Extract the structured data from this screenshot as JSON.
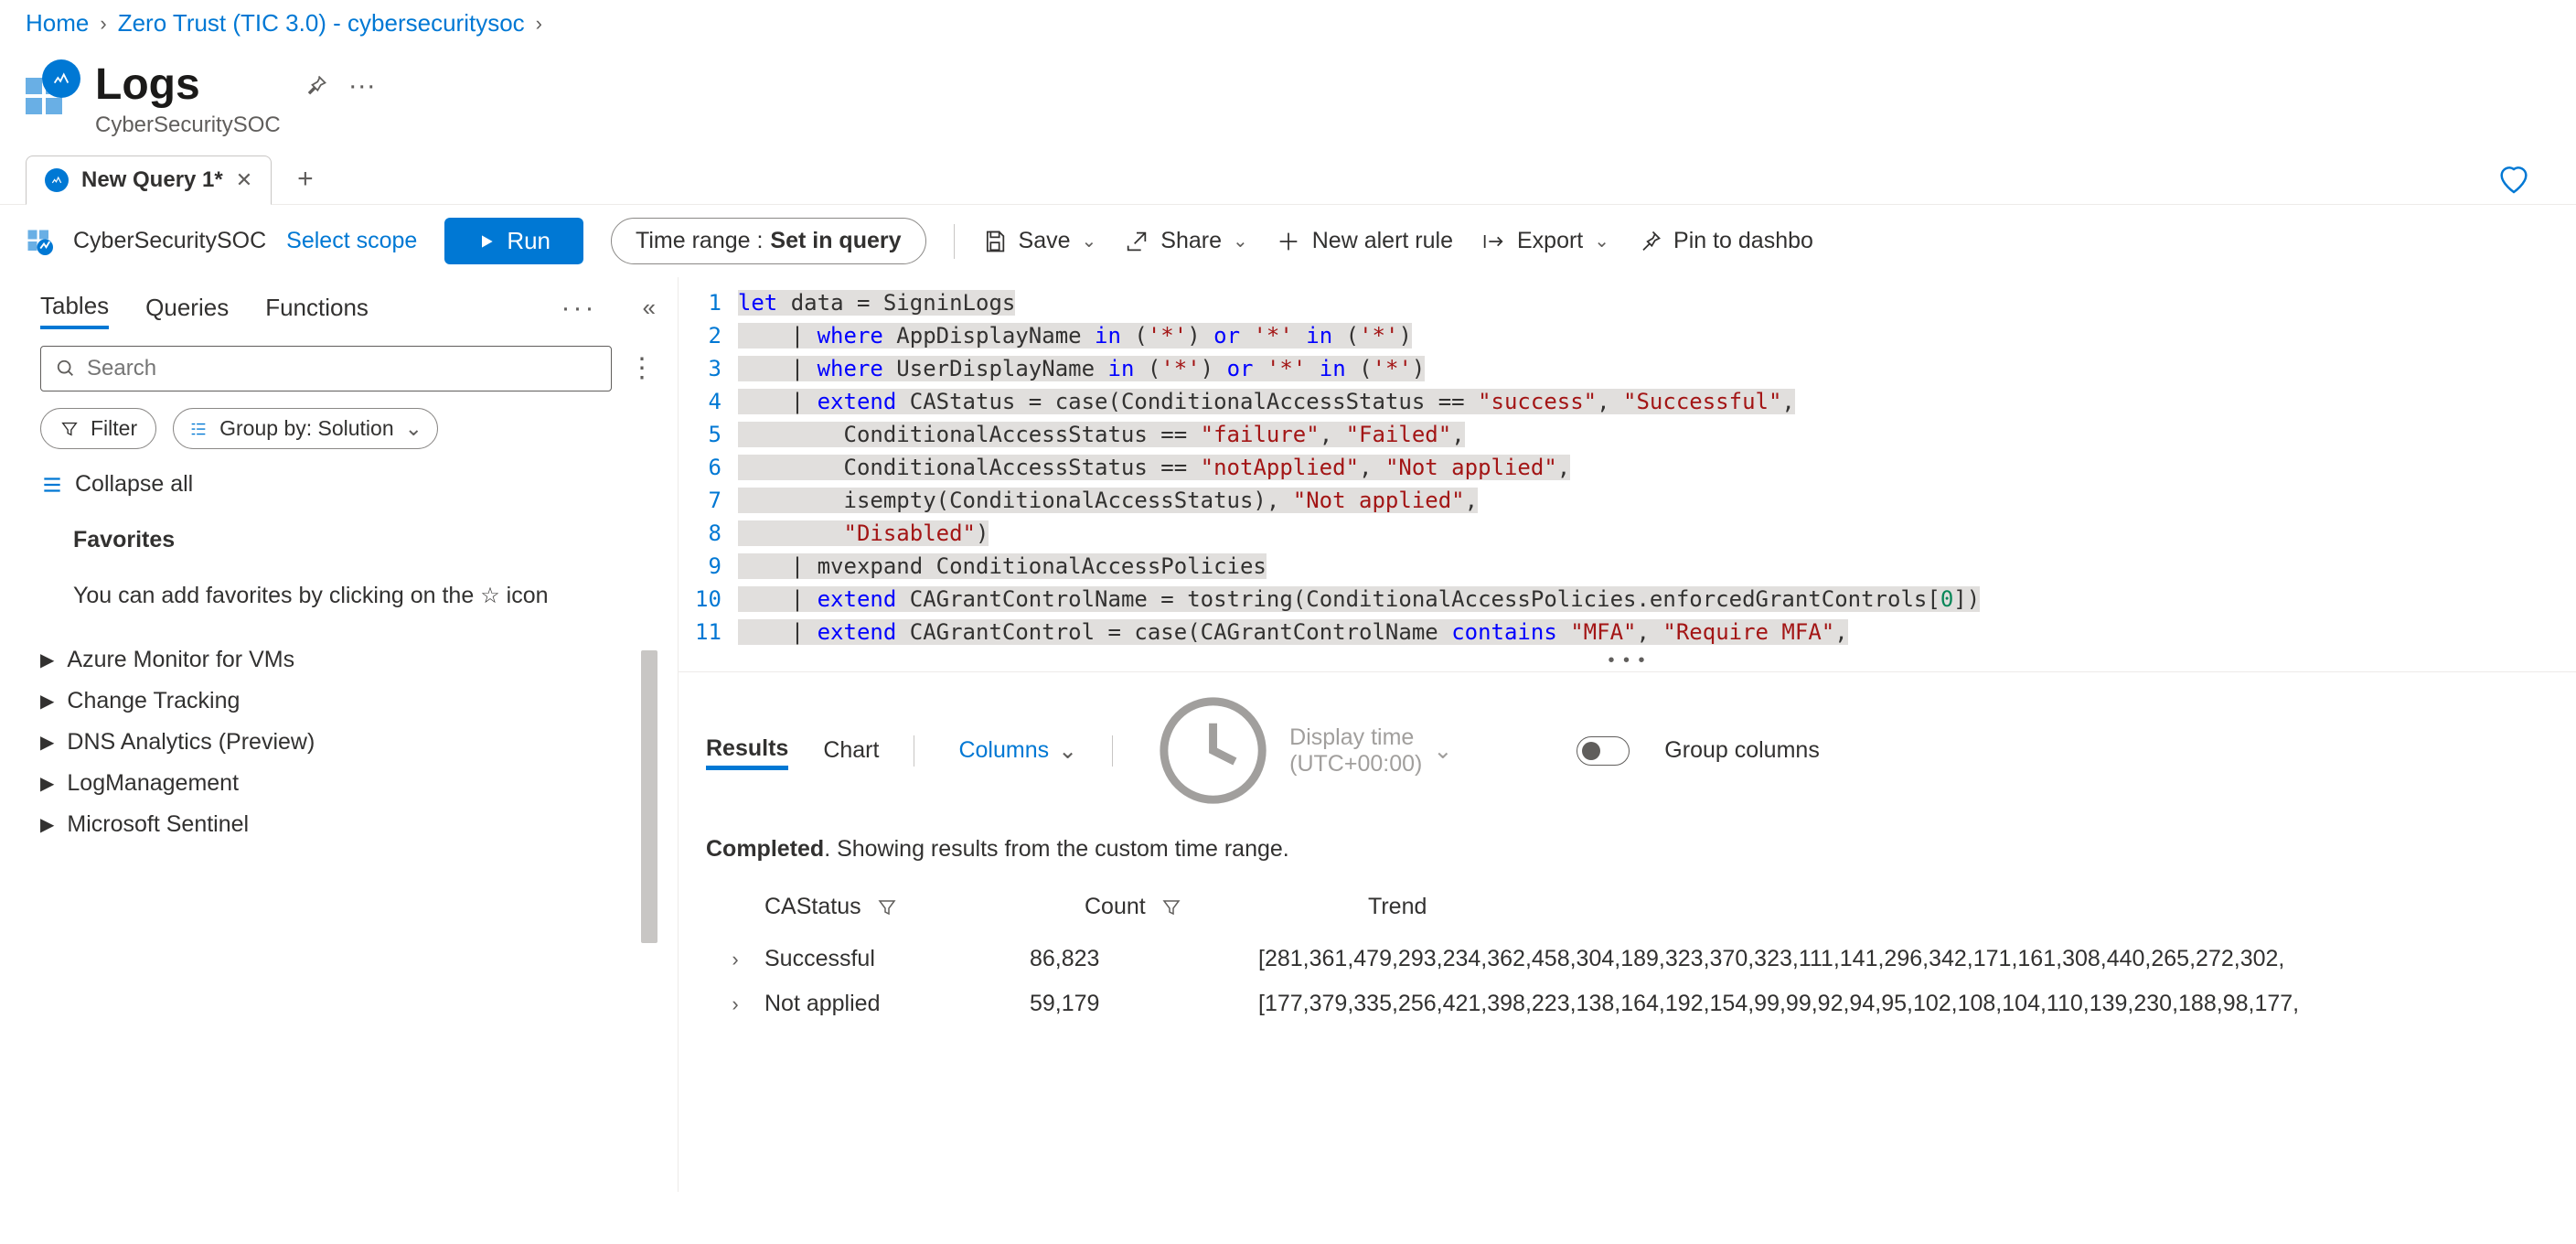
{
  "breadcrumb": {
    "home": "Home",
    "item1": "Zero Trust (TIC 3.0) - cybersecuritysoc"
  },
  "header": {
    "title": "Logs",
    "subtitle": "CyberSecuritySOC"
  },
  "tab": {
    "name": "New Query 1*"
  },
  "scope": {
    "workspace": "CyberSecuritySOC",
    "select": "Select scope"
  },
  "toolbar": {
    "run": "Run",
    "time_label": "Time range :",
    "time_value": "Set in query",
    "save": "Save",
    "share": "Share",
    "new_alert": "New alert rule",
    "export": "Export",
    "pin": "Pin to dashbo"
  },
  "side": {
    "tabs": {
      "tables": "Tables",
      "queries": "Queries",
      "functions": "Functions"
    },
    "search_placeholder": "Search",
    "filter": "Filter",
    "groupby": "Group by: Solution",
    "collapse": "Collapse all",
    "favorites": "Favorites",
    "hint_pre": "You can add favorites by clicking on the ",
    "hint_post": " icon",
    "items": [
      "Azure Monitor for VMs",
      "Change Tracking",
      "DNS Analytics (Preview)",
      "LogManagement",
      "Microsoft Sentinel"
    ]
  },
  "editor": {
    "line_count": 11,
    "line1": "let data = SigninLogs",
    "line2": "    | where AppDisplayName in ('*') or '*' in ('*')",
    "line3": "    | where UserDisplayName in ('*') or '*' in ('*')",
    "line4": "    | extend CAStatus = case(ConditionalAccessStatus == \"success\", \"Successful\",",
    "line5": "        ConditionalAccessStatus == \"failure\", \"Failed\",",
    "line6": "        ConditionalAccessStatus == \"notApplied\", \"Not applied\",",
    "line7": "        isempty(ConditionalAccessStatus), \"Not applied\",",
    "line8": "        \"Disabled\")",
    "line9": "    | mvexpand ConditionalAccessPolicies",
    "line10": "    | extend CAGrantControlName = tostring(ConditionalAccessPolicies.enforcedGrantControls[0])",
    "line11": "    | extend CAGrantControl = case(CAGrantControlName contains \"MFA\", \"Require MFA\","
  },
  "results": {
    "tab_results": "Results",
    "tab_chart": "Chart",
    "columns": "Columns",
    "display_time": "Display time (UTC+00:00)",
    "group": "Group columns",
    "status_bold": "Completed",
    "status_rest": ". Showing results from the custom time range.",
    "cols": {
      "c1": "CAStatus",
      "c2": "Count",
      "c3": "Trend"
    },
    "rows": [
      {
        "status": "Successful",
        "count": "86,823",
        "trend": "[281,361,479,293,234,362,458,304,189,323,370,323,111,141,296,342,171,161,308,440,265,272,302,"
      },
      {
        "status": "Not applied",
        "count": "59,179",
        "trend": "[177,379,335,256,421,398,223,138,164,192,154,99,99,92,94,95,102,108,104,110,139,230,188,98,177,"
      }
    ]
  }
}
